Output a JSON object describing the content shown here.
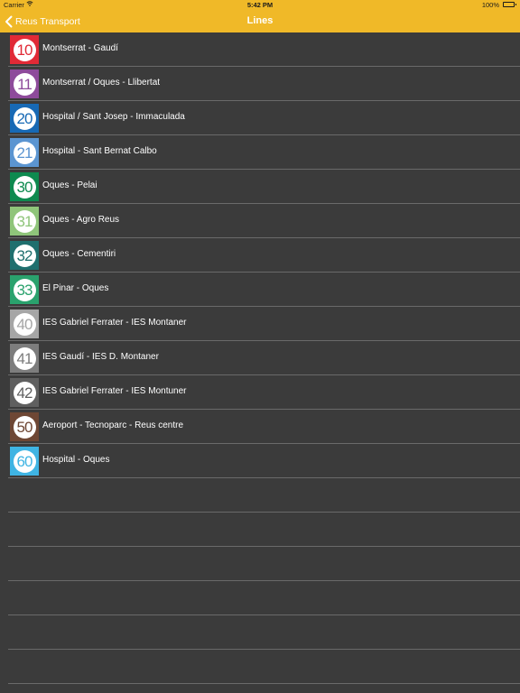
{
  "status_bar": {
    "carrier": "Carrier",
    "time": "5:42 PM",
    "battery": "100%"
  },
  "nav": {
    "back_label": "Reus Transport",
    "title": "Lines"
  },
  "lines": [
    {
      "number": "10",
      "name": "Montserrat - Gaudí",
      "color": "#e12a36"
    },
    {
      "number": "11",
      "name": "Montserrat / Oques - Llibertat",
      "color": "#8e4b9b"
    },
    {
      "number": "20",
      "name": "Hospital / Sant Josep - Immaculada",
      "color": "#1769b5"
    },
    {
      "number": "21",
      "name": "Hospital - Sant Bernat Calbo",
      "color": "#5b95d1"
    },
    {
      "number": "30",
      "name": "Oques - Pelai",
      "color": "#0e8a4f"
    },
    {
      "number": "31",
      "name": "Oques - Agro Reus",
      "color": "#8fc57a"
    },
    {
      "number": "32",
      "name": "Oques - Cementiri",
      "color": "#1f6f6e"
    },
    {
      "number": "33",
      "name": "El Pinar - Oques",
      "color": "#2aa26d"
    },
    {
      "number": "40",
      "name": "IES Gabriel Ferrater - IES Montaner",
      "color": "#a6a6a6"
    },
    {
      "number": "41",
      "name": "IES Gaudí - IES D. Montaner",
      "color": "#7d7d7d"
    },
    {
      "number": "42",
      "name": "IES Gabriel Ferrater - IES Montuner",
      "color": "#5f5f5f"
    },
    {
      "number": "50",
      "name": "Aeroport - Tecnoparc - Reus centre",
      "color": "#6e4734"
    },
    {
      "number": "60",
      "name": "Hospital - Oques",
      "color": "#3fb4e3"
    }
  ]
}
